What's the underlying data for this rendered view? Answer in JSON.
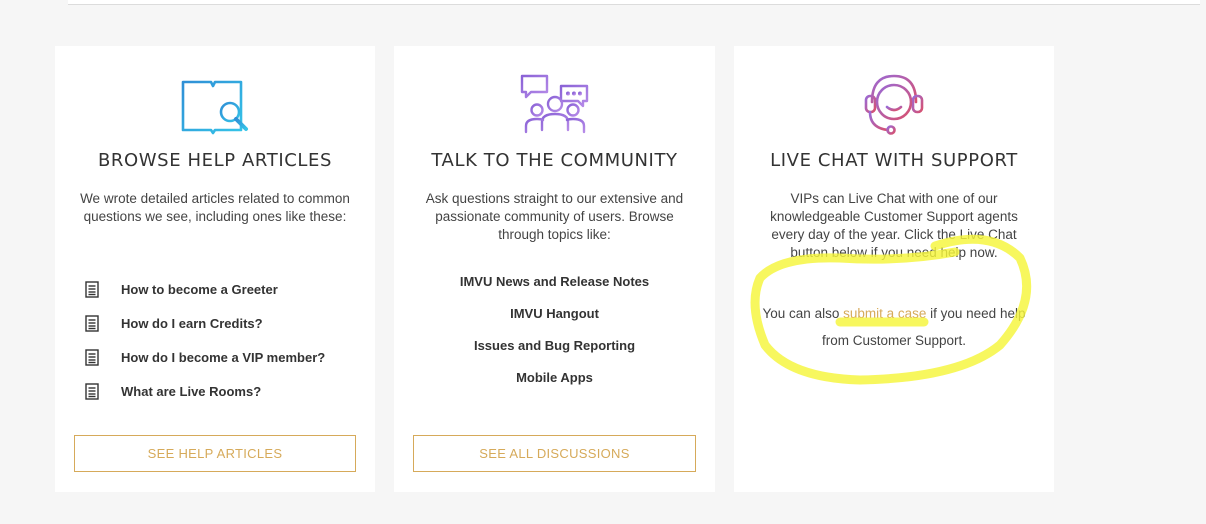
{
  "cards": {
    "browse": {
      "icon": "book-search-icon",
      "title": "BROWSE HELP ARTICLES",
      "description": "We wrote detailed articles related to common questions we see, including ones like these:",
      "articles": [
        "How to become a Greeter",
        "How do I earn Credits?",
        "How do I become a VIP member?",
        "What are Live Rooms?"
      ],
      "button_label": "SEE HELP ARTICLES"
    },
    "community": {
      "icon": "community-chat-icon",
      "title": "TALK TO THE COMMUNITY",
      "description": "Ask questions straight to our extensive and passionate community of users. Browse through topics like:",
      "topics": [
        "IMVU News and Release Notes",
        "IMVU Hangout",
        "Issues and Bug Reporting",
        "Mobile Apps"
      ],
      "button_label": "SEE ALL DISCUSSIONS"
    },
    "livechat": {
      "icon": "headset-smiley-icon",
      "title": "LIVE CHAT WITH SUPPORT",
      "description": "VIPs can Live Chat with one of our knowledgeable Customer Support agents every day of the year. Click the Live Chat button below if you need help now.",
      "extra_prefix": "You can also ",
      "extra_link": "submit a case",
      "extra_suffix": " if you need help from Customer Support."
    }
  },
  "colors": {
    "accent": "#d6aa5a",
    "highlight_marker": "#f5f53a",
    "browse_icon": "#3aa6e0",
    "community_icon": "#9a6fd8",
    "livechat_icon": "#b0609a"
  }
}
